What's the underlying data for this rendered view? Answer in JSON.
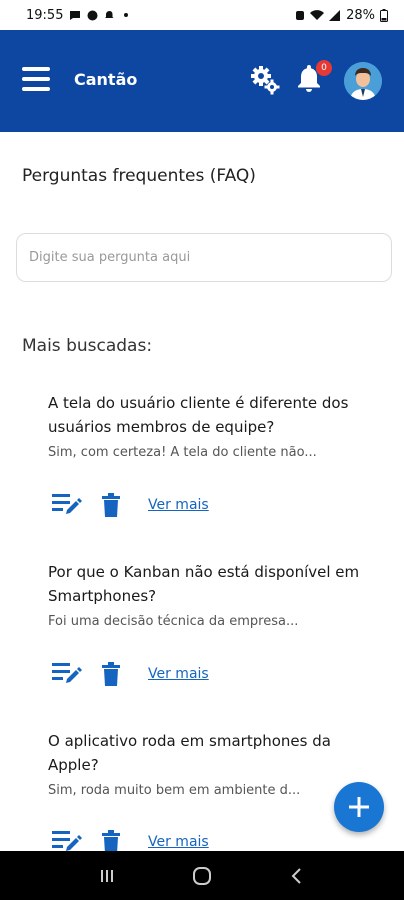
{
  "status_bar": {
    "time": "19:55",
    "battery": "28%"
  },
  "app_bar": {
    "title": "Cantão",
    "notification_count": "0"
  },
  "page": {
    "title": "Perguntas frequentes (FAQ)"
  },
  "search": {
    "placeholder": "Digite sua pergunta aqui"
  },
  "section": {
    "title": "Mais buscadas:"
  },
  "faqs": [
    {
      "question": "A tela do usuário cliente é diferente dos usuários membros de equipe?",
      "answer": "Sim, com certeza! A tela do cliente não...",
      "link": "Ver mais"
    },
    {
      "question": "Por que o Kanban não está disponível em Smartphones?",
      "answer": "Foi uma decisão técnica da empresa...",
      "link": "Ver mais"
    },
    {
      "question": "O aplicativo roda em smartphones da Apple?",
      "answer": "Sim, roda muito bem em ambiente d...",
      "link": "Ver mais"
    }
  ],
  "colors": {
    "primary": "#0d47a1",
    "accent": "#1976d2",
    "badge": "#e53935"
  },
  "icons": [
    "menu-icon",
    "gear-icon",
    "bell-icon",
    "avatar",
    "edit-icon",
    "delete-icon",
    "add-icon"
  ]
}
